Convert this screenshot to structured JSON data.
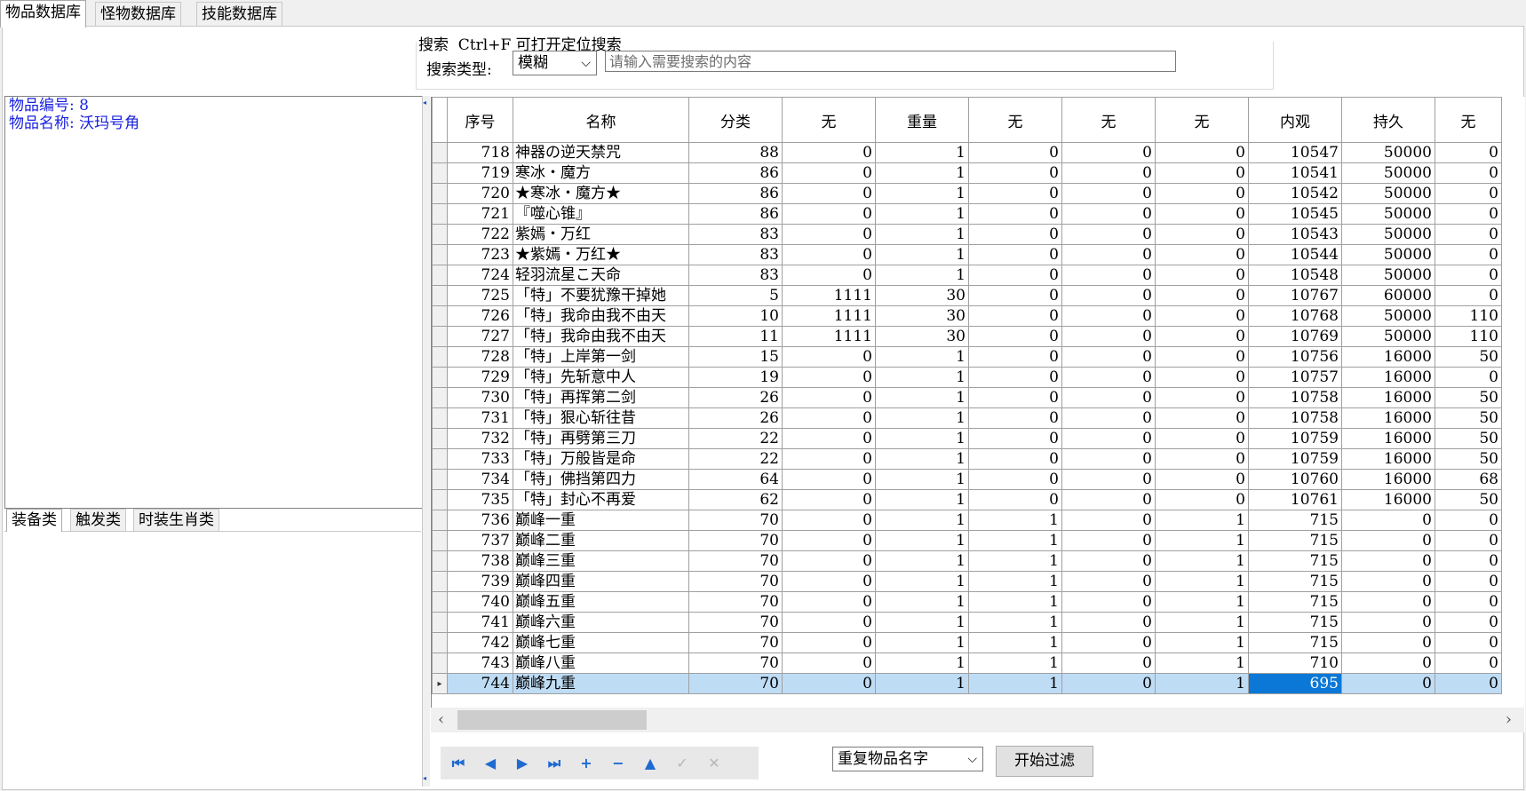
{
  "tabs": [
    "物品数据库",
    "怪物数据库",
    "技能数据库"
  ],
  "search": {
    "title": "搜索  Ctrl+F 可打开定位搜索",
    "type_label": "搜索类型:",
    "type_value": "模糊",
    "placeholder": "请输入需要搜索的内容"
  },
  "item_info": {
    "number_line": "物品编号: 8",
    "name_line": "物品名称: 沃玛号角"
  },
  "sub_tabs": [
    "装备类",
    "触发类",
    "时装生肖类"
  ],
  "grid": {
    "columns": [
      "序号",
      "名称",
      "分类",
      "无",
      "重量",
      "无",
      "无",
      "无",
      "内观",
      "持久",
      "无"
    ],
    "rows": [
      [
        "718",
        "神器の逆天禁咒",
        "88",
        "0",
        "1",
        "0",
        "0",
        "0",
        "10547",
        "50000",
        "0"
      ],
      [
        "719",
        "寒冰・魔方",
        "86",
        "0",
        "1",
        "0",
        "0",
        "0",
        "10541",
        "50000",
        "0"
      ],
      [
        "720",
        "★寒冰・魔方★",
        "86",
        "0",
        "1",
        "0",
        "0",
        "0",
        "10542",
        "50000",
        "0"
      ],
      [
        "721",
        "『噬心锥』",
        "86",
        "0",
        "1",
        "0",
        "0",
        "0",
        "10545",
        "50000",
        "0"
      ],
      [
        "722",
        "紫嫣・万红",
        "83",
        "0",
        "1",
        "0",
        "0",
        "0",
        "10543",
        "50000",
        "0"
      ],
      [
        "723",
        "★紫嫣・万红★",
        "83",
        "0",
        "1",
        "0",
        "0",
        "0",
        "10544",
        "50000",
        "0"
      ],
      [
        "724",
        "轻羽流星こ天命",
        "83",
        "0",
        "1",
        "0",
        "0",
        "0",
        "10548",
        "50000",
        "0"
      ],
      [
        "725",
        "「特」不要犹豫干掉她",
        "5",
        "1111",
        "30",
        "0",
        "0",
        "0",
        "10767",
        "60000",
        "0"
      ],
      [
        "726",
        "「特」我命由我不由天",
        "10",
        "1111",
        "30",
        "0",
        "0",
        "0",
        "10768",
        "50000",
        "110"
      ],
      [
        "727",
        "「特」我命由我不由天",
        "11",
        "1111",
        "30",
        "0",
        "0",
        "0",
        "10769",
        "50000",
        "110"
      ],
      [
        "728",
        "「特」上岸第一剑",
        "15",
        "0",
        "1",
        "0",
        "0",
        "0",
        "10756",
        "16000",
        "50"
      ],
      [
        "729",
        "「特」先斩意中人",
        "19",
        "0",
        "1",
        "0",
        "0",
        "0",
        "10757",
        "16000",
        "0"
      ],
      [
        "730",
        "「特」再挥第二剑",
        "26",
        "0",
        "1",
        "0",
        "0",
        "0",
        "10758",
        "16000",
        "50"
      ],
      [
        "731",
        "「特」狠心斩往昔",
        "26",
        "0",
        "1",
        "0",
        "0",
        "0",
        "10758",
        "16000",
        "50"
      ],
      [
        "732",
        "「特」再劈第三刀",
        "22",
        "0",
        "1",
        "0",
        "0",
        "0",
        "10759",
        "16000",
        "50"
      ],
      [
        "733",
        "「特」万般皆是命",
        "22",
        "0",
        "1",
        "0",
        "0",
        "0",
        "10759",
        "16000",
        "50"
      ],
      [
        "734",
        "「特」佛挡第四力",
        "64",
        "0",
        "1",
        "0",
        "0",
        "0",
        "10760",
        "16000",
        "68"
      ],
      [
        "735",
        "「特」封心不再爱",
        "62",
        "0",
        "1",
        "0",
        "0",
        "0",
        "10761",
        "16000",
        "50"
      ],
      [
        "736",
        "巅峰一重",
        "70",
        "0",
        "1",
        "1",
        "0",
        "1",
        "715",
        "0",
        "0"
      ],
      [
        "737",
        "巅峰二重",
        "70",
        "0",
        "1",
        "1",
        "0",
        "1",
        "715",
        "0",
        "0"
      ],
      [
        "738",
        "巅峰三重",
        "70",
        "0",
        "1",
        "1",
        "0",
        "1",
        "715",
        "0",
        "0"
      ],
      [
        "739",
        "巅峰四重",
        "70",
        "0",
        "1",
        "1",
        "0",
        "1",
        "715",
        "0",
        "0"
      ],
      [
        "740",
        "巅峰五重",
        "70",
        "0",
        "1",
        "1",
        "0",
        "1",
        "715",
        "0",
        "0"
      ],
      [
        "741",
        "巅峰六重",
        "70",
        "0",
        "1",
        "1",
        "0",
        "1",
        "715",
        "0",
        "0"
      ],
      [
        "742",
        "巅峰七重",
        "70",
        "0",
        "1",
        "1",
        "0",
        "1",
        "715",
        "0",
        "0"
      ],
      [
        "743",
        "巅峰八重",
        "70",
        "0",
        "1",
        "1",
        "0",
        "1",
        "710",
        "0",
        "0"
      ],
      [
        "744",
        "巅峰九重",
        "70",
        "0",
        "1",
        "1",
        "0",
        "1",
        "695",
        "0",
        "0"
      ]
    ],
    "selected_row_index": 26,
    "current_row_marker": "▸"
  },
  "filter": {
    "select_value": "重复物品名字",
    "button_label": "开始过滤"
  },
  "nav_icons": [
    "first-record-icon",
    "prev-record-icon",
    "next-record-icon",
    "last-record-icon",
    "insert-record-icon",
    "delete-record-icon",
    "edit-record-icon",
    "post-record-icon",
    "cancel-record-icon"
  ]
}
